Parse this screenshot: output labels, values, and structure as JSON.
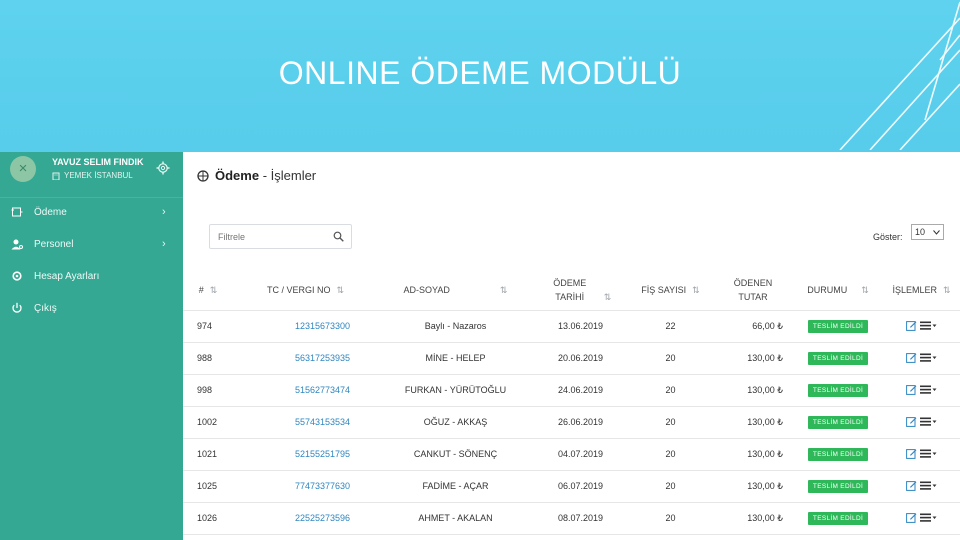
{
  "slide": {
    "title": "ONLINE ÖDEME MODÜLÜ"
  },
  "sidebar": {
    "avatar_glyph": "×",
    "user_name": "YAVUZ SELIM FINDIK",
    "company": "YEMEK İSTANBUL",
    "items": [
      {
        "label": "Ödeme",
        "icon": "payment-icon",
        "has_submenu": true
      },
      {
        "label": "Personel",
        "icon": "person-icon",
        "has_submenu": true
      },
      {
        "label": "Hesap Ayarları",
        "icon": "settings-icon",
        "has_submenu": false
      },
      {
        "label": "Çıkış",
        "icon": "power-icon",
        "has_submenu": false
      }
    ],
    "chevron": "›"
  },
  "main": {
    "title_bold": "Ödeme",
    "title_rest": " - İşlemler",
    "filter_placeholder": "Filtrele",
    "show_label": "Göster:",
    "show_value": "10"
  },
  "table": {
    "headers": [
      "#",
      "TC / VERGI NO",
      "AD-SOYAD",
      "ÖDEME TARİHİ",
      "FİŞ SAYISI",
      "ÖDENEN TUTAR",
      "DURUMU",
      "İŞLEMLER"
    ],
    "rows": [
      {
        "id": "974",
        "tc": "12315673300",
        "name": "Baylı - Nazaros",
        "date": "13.06.2019",
        "count": "22",
        "amount": "66,00 ₺",
        "status": "TESLİM EDİLDİ"
      },
      {
        "id": "988",
        "tc": "56317253935",
        "name": "MİNE - HELEP",
        "date": "20.06.2019",
        "count": "20",
        "amount": "130,00 ₺",
        "status": "TESLİM EDİLDİ"
      },
      {
        "id": "998",
        "tc": "51562773474",
        "name": "FURKAN - YÜRÜTOĞLU",
        "date": "24.06.2019",
        "count": "20",
        "amount": "130,00 ₺",
        "status": "TESLİM EDİLDİ"
      },
      {
        "id": "1002",
        "tc": "55743153534",
        "name": "OĞUZ - AKKAŞ",
        "date": "26.06.2019",
        "count": "20",
        "amount": "130,00 ₺",
        "status": "TESLİM EDİLDİ"
      },
      {
        "id": "1021",
        "tc": "52155251795",
        "name": "CANKUT - SÖNENÇ",
        "date": "04.07.2019",
        "count": "20",
        "amount": "130,00 ₺",
        "status": "TESLİM EDİLDİ"
      },
      {
        "id": "1025",
        "tc": "77473377630",
        "name": "FADİME - AÇAR",
        "date": "06.07.2019",
        "count": "20",
        "amount": "130,00 ₺",
        "status": "TESLİM EDİLDİ"
      },
      {
        "id": "1026",
        "tc": "22525273596",
        "name": "AHMET - AKALAN",
        "date": "08.07.2019",
        "count": "20",
        "amount": "130,00 ₺",
        "status": "TESLİM EDİLDİ"
      }
    ]
  },
  "colors": {
    "banner": "#5ed2ee",
    "sidebar": "#34a893",
    "link": "#2e86c1",
    "badge": "#2fb85a"
  }
}
